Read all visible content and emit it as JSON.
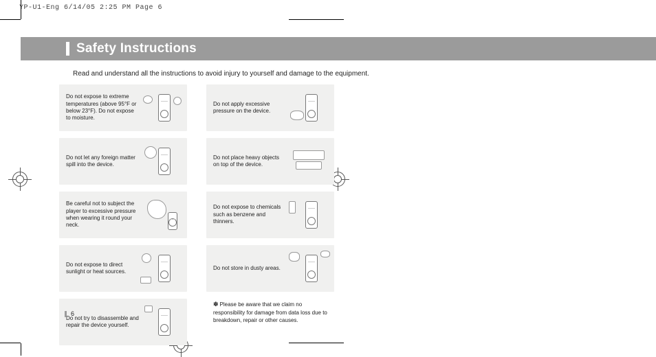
{
  "printHeader": "YP-U1-Eng  6/14/05 2:25 PM  Page 6",
  "title": "Safety Instructions",
  "intro": "Read and understand all the instructions to avoid injury to yourself and damage to the equipment.",
  "leftColumn": [
    "Do not expose to extreme temperatures (above 95°F or below 23°F). Do not expose to moisture.",
    "Do not let any foreign matter spill into the device.",
    "Be careful not to subject the player to excessive pressure when wearing it round your neck.",
    "Do not expose to direct sunlight or heat sources.",
    "Do not try to disassemble and repair the device yourself."
  ],
  "rightColumn": [
    "Do not apply excessive pressure on the device.",
    "Do not place heavy objects on top of the device.",
    "Do not expose to chemicals such as benzene and thinners.",
    "Do not store in dusty areas."
  ],
  "disclaimerMark": "✽",
  "disclaimer": "Please be aware that we claim no responsibility for damage from data loss due to breakdown, repair or other causes.",
  "pageNumber": "6"
}
